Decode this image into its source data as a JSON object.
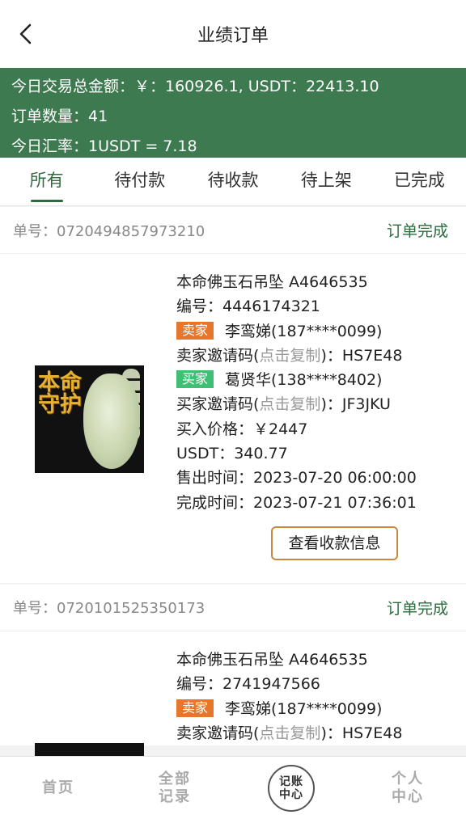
{
  "header": {
    "title": "业绩订单",
    "back_icon": "chevron-left-icon"
  },
  "summary": {
    "total_line": "今日交易总金额：￥：160926.1, USDT：22413.10",
    "count_line": "订单数量：41",
    "rate_line": "今日汇率：1USDT = 7.18",
    "bg_color": "#3d7a4f"
  },
  "tabs": [
    {
      "label": "所有",
      "active": true
    },
    {
      "label": "待付款",
      "active": false
    },
    {
      "label": "待收款",
      "active": false
    },
    {
      "label": "待上架",
      "active": false
    },
    {
      "label": "已完成",
      "active": false
    }
  ],
  "orders": [
    {
      "order_no": "单号：0720494857973210",
      "status": "订单完成",
      "product_name": "本命佛玉石吊坠 A4646535",
      "code": "编号：4446174321",
      "seller_badge": "卖家",
      "seller": "李鸾娣(187****0099)",
      "seller_invite_prefix": "卖家邀请码(",
      "copy_hint": "点击复制",
      "seller_invite_suffix": ")：HS7E48",
      "buyer_badge": "买家",
      "buyer": "葛贤华(138****8402)",
      "buyer_invite_prefix": "买家邀请码(",
      "buyer_invite_suffix": ")：JF3JKU",
      "price": "买入价格：￥2447",
      "usdt": "USDT：340.77",
      "sold_time": "售出时间：2023-07-20 06:00:00",
      "done_time": "完成时间：2023-07-21 07:36:01",
      "action_label": "查看收款信息",
      "thumb_text": "本命守护"
    },
    {
      "order_no": "单号：0720101525350173",
      "status": "订单完成",
      "product_name": "本命佛玉石吊坠 A4646535",
      "code": "编号：2741947566",
      "seller_badge": "卖家",
      "seller": "李鸾娣(187****0099)",
      "seller_invite_prefix": "卖家邀请码(",
      "copy_hint": "点击复制",
      "seller_invite_suffix": ")：HS7E48"
    }
  ],
  "bottom_nav": [
    {
      "label": "首页"
    },
    {
      "label": "全部记录"
    },
    {
      "label": "记账中心"
    },
    {
      "label": "个人中心"
    }
  ],
  "colors": {
    "accent_green": "#2e6b3f",
    "seller_badge": "#e8762a",
    "buyer_badge": "#3fbf73",
    "button_border": "#c9893d"
  }
}
